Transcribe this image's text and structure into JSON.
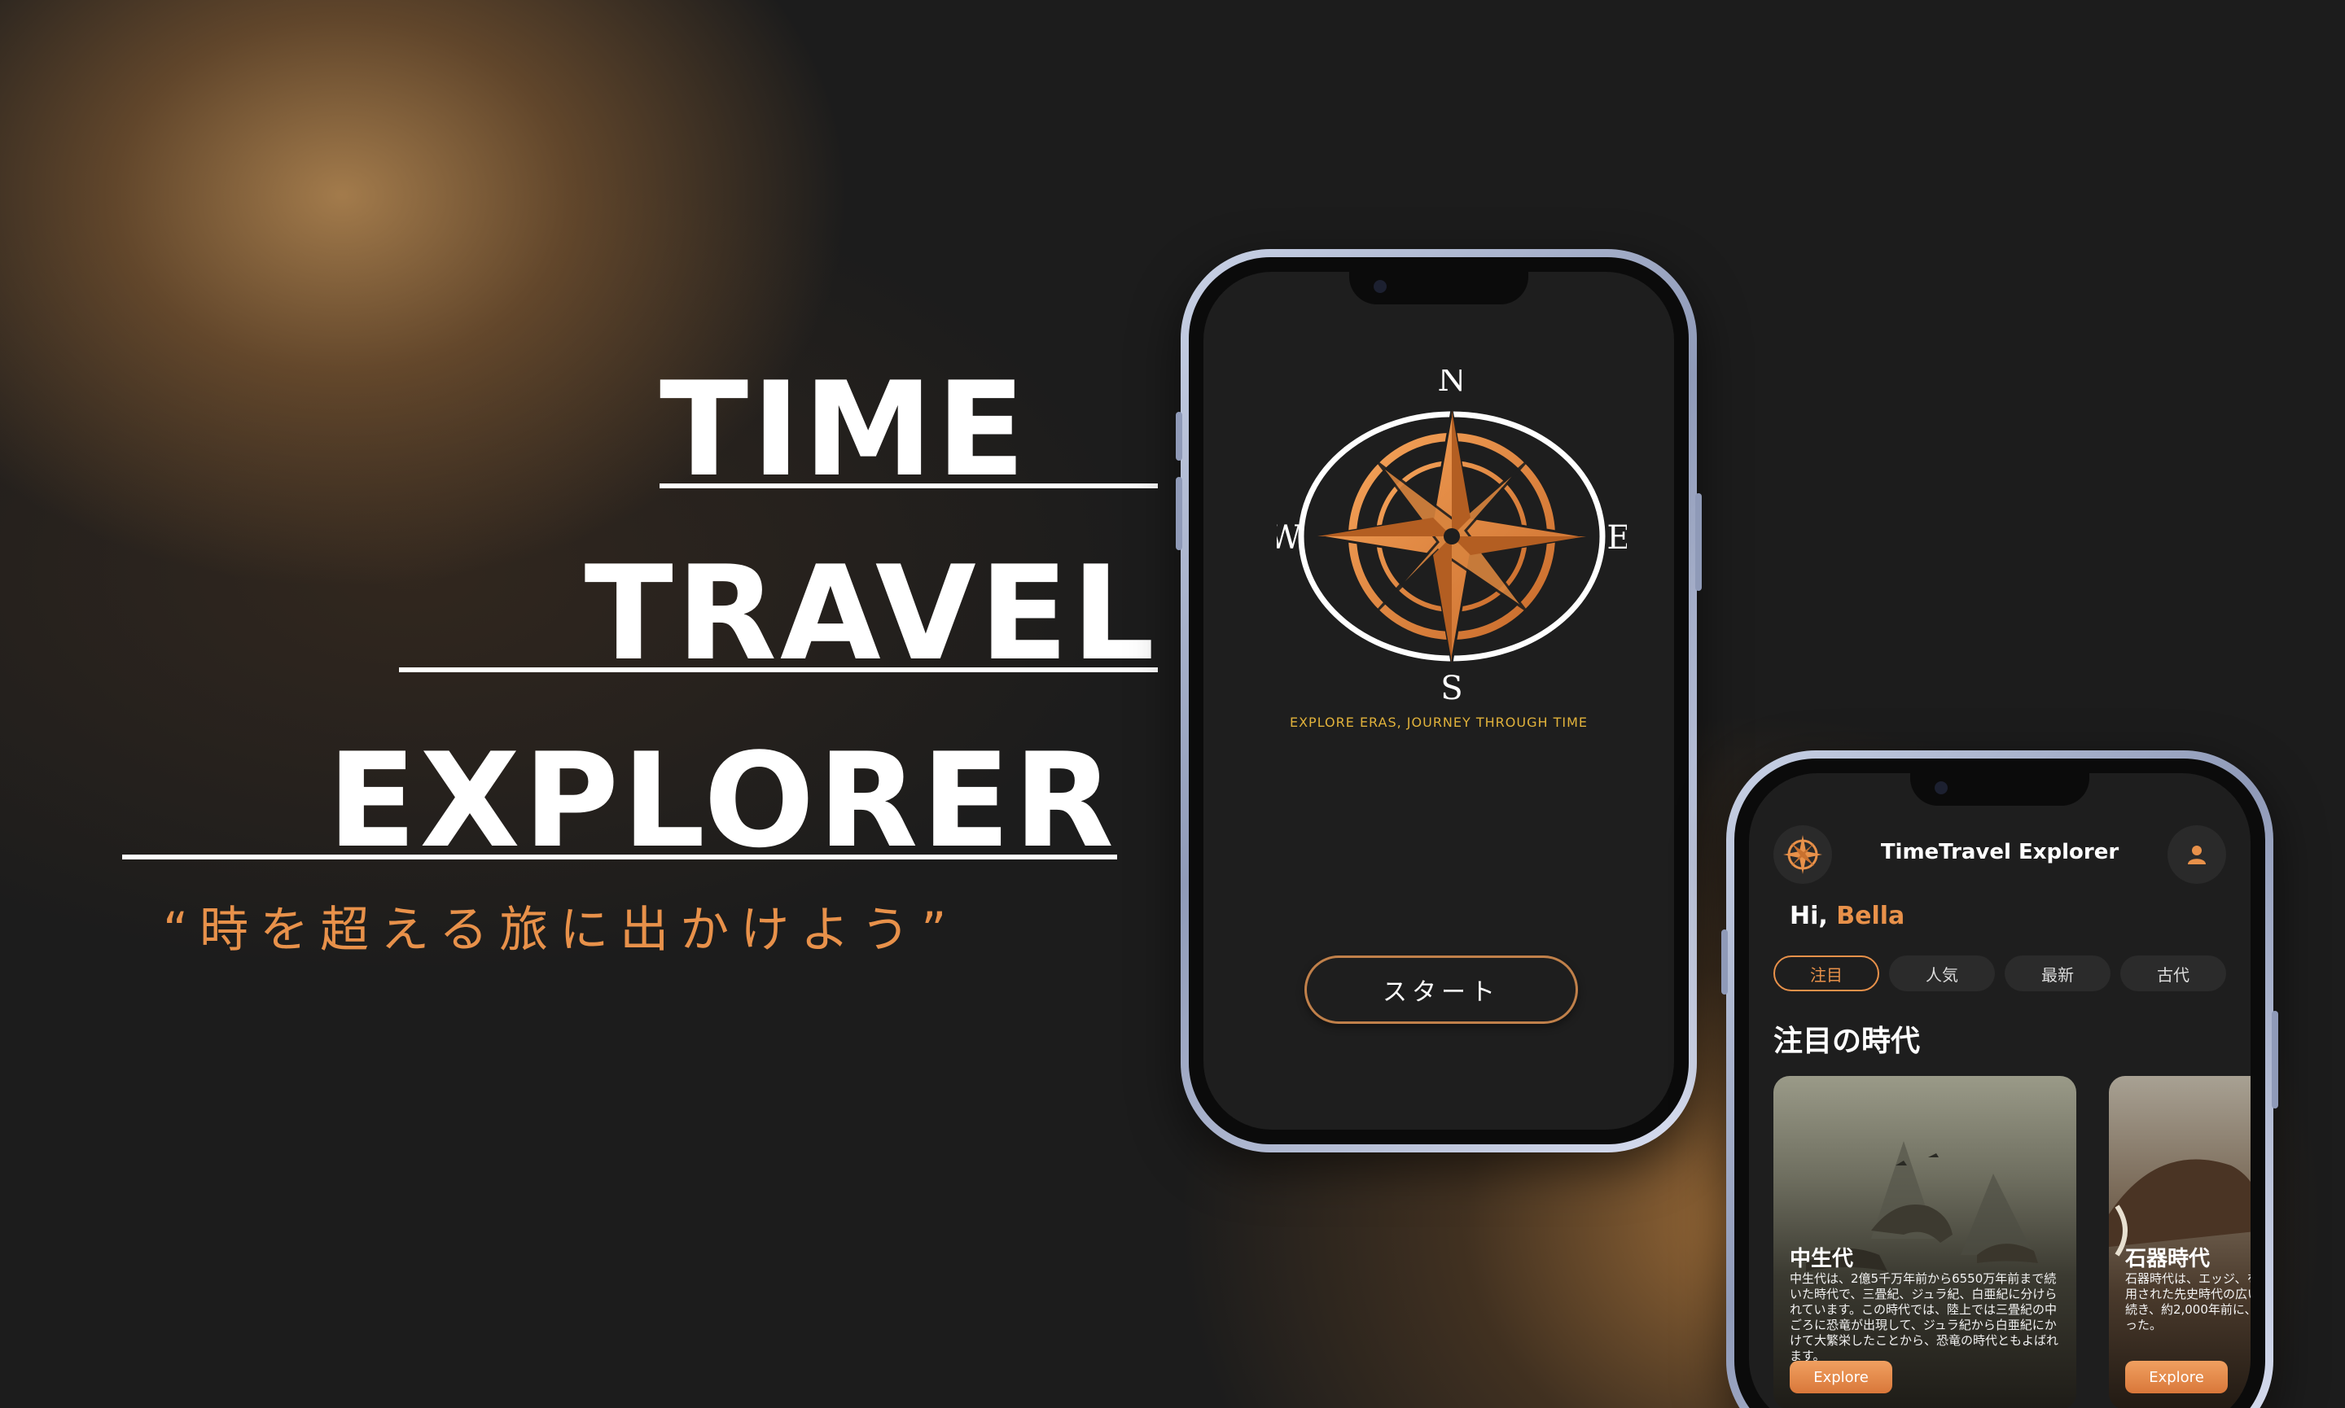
{
  "hero": {
    "title_line1": "TIME",
    "title_line2": "TRAVEL",
    "title_line3": "EXPLORER",
    "subtitle": "“時を超える旅に出かけよう”"
  },
  "splash_screen": {
    "compass": {
      "n": "N",
      "s": "S",
      "e": "E",
      "w": "W"
    },
    "tagline": "EXPLORE ERAS, JOURNEY THROUGH TIME",
    "start_button": "スタート"
  },
  "home_screen": {
    "header_title": "TimeTravel Explorer",
    "greeting_prefix": "Hi, ",
    "greeting_name": "Bella",
    "tabs": [
      {
        "label": "注目"
      },
      {
        "label": "人気"
      },
      {
        "label": "最新"
      },
      {
        "label": "古代"
      }
    ],
    "section_title": "注目の時代",
    "cards": [
      {
        "title": "中生代",
        "description": "中生代は、2億5千万年前から6550万年前まで続いた時代で、三畳紀、ジュラ紀、白亜紀に分けられています。この時代では、陸上では三畳紀の中ごろに恐竜が出現して、ジュラ紀から白亜紀にかけて大繁栄したことから、恐竜の時代ともよばれます。",
        "button": "Explore"
      },
      {
        "title": "石器時代",
        "description": "石器時代は、エッジ、を持つ石器を作るために使用された先史時代の広い時代で、およそ340万年続き、約2,000年前に、金属が使われ始めて終わった。",
        "button": "Explore"
      }
    ]
  },
  "colors": {
    "accent": "#e8914a",
    "tagline": "#e1b23b",
    "background": "#1c1c1c"
  }
}
